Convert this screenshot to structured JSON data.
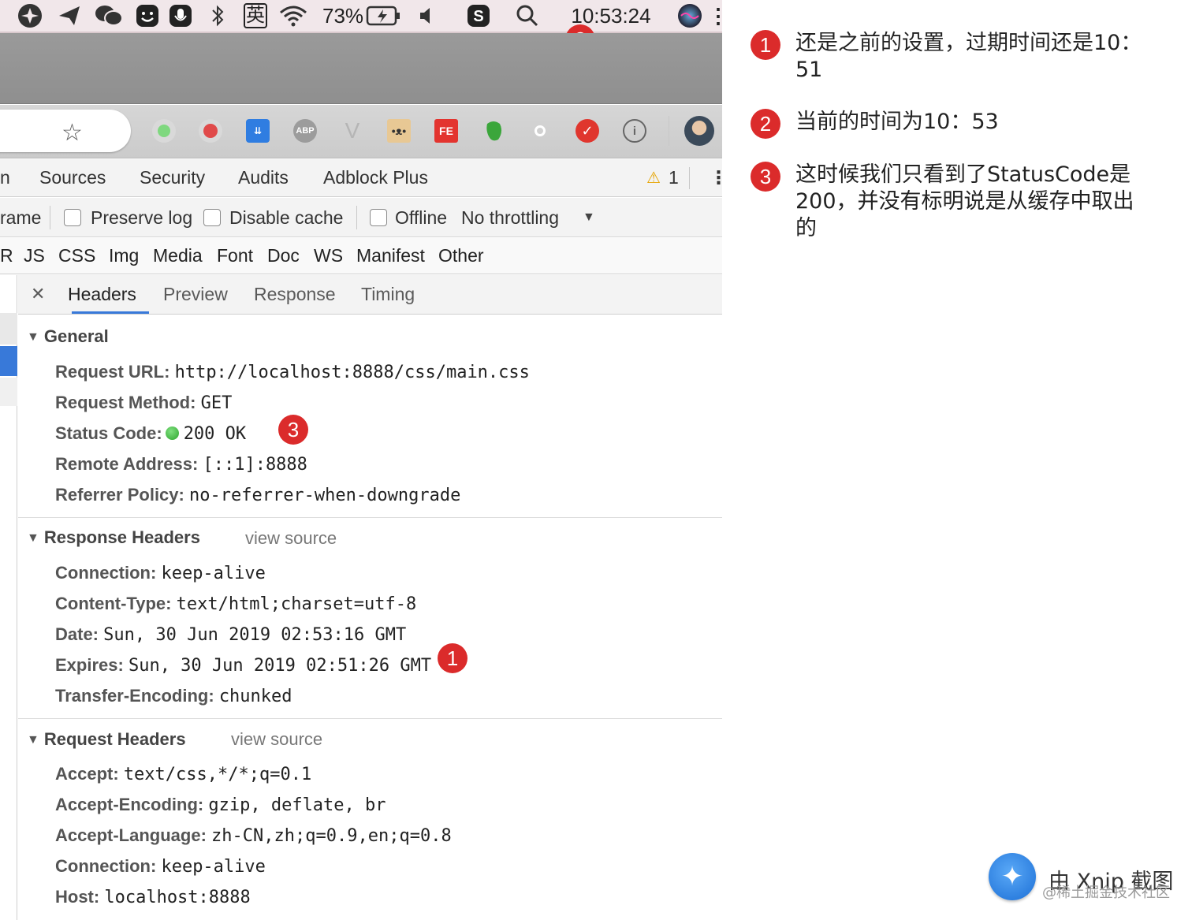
{
  "menubar": {
    "icons": [
      "app-icon",
      "send-icon",
      "wechat-icon",
      "smile-icon",
      "mic-icon",
      "bluetooth-icon",
      "input-method-icon",
      "wifi-icon",
      "battery-icon",
      "volume-icon",
      "s-app-icon",
      "search-icon",
      "siri-icon"
    ],
    "input_method": "英",
    "battery": "73%",
    "clock": "10:53:24"
  },
  "toolbar": {
    "extension_icons": [
      "green-dot-icon",
      "red-dot-icon",
      "download-icon",
      "adblock-plus-icon",
      "vue-icon",
      "cat-icon",
      "fe-icon",
      "evernote-icon",
      "circle-icon",
      "todoist-icon",
      "info-icon"
    ],
    "abp_label": "ABP",
    "fe_label": "FE"
  },
  "devtools": {
    "tabs": [
      "n",
      "Sources",
      "Security",
      "Audits",
      "Adblock Plus"
    ],
    "warning_count": "1",
    "netbar": {
      "frame_label": "rame",
      "preserve_log": "Preserve log",
      "disable_cache": "Disable cache",
      "offline": "Offline",
      "throttling": "No throttling"
    },
    "filters": [
      "R",
      "JS",
      "CSS",
      "Img",
      "Media",
      "Font",
      "Doc",
      "WS",
      "Manifest",
      "Other"
    ],
    "detail_tabs": [
      "Headers",
      "Preview",
      "Response",
      "Timing"
    ],
    "general": {
      "title": "General",
      "rows": [
        {
          "key": "Request URL:",
          "value": "http://localhost:8888/css/main.css"
        },
        {
          "key": "Request Method:",
          "value": "GET"
        },
        {
          "key": "Status Code:",
          "value": "200 OK"
        },
        {
          "key": "Remote Address:",
          "value": "[::1]:8888"
        },
        {
          "key": "Referrer Policy:",
          "value": "no-referrer-when-downgrade"
        }
      ]
    },
    "response_headers": {
      "title": "Response Headers",
      "view_source": "view source",
      "rows": [
        {
          "key": "Connection:",
          "value": "keep-alive"
        },
        {
          "key": "Content-Type:",
          "value": "text/html;charset=utf-8"
        },
        {
          "key": "Date:",
          "value": "Sun, 30 Jun 2019 02:53:16 GMT"
        },
        {
          "key": "Expires:",
          "value": "Sun, 30 Jun 2019 02:51:26 GMT"
        },
        {
          "key": "Transfer-Encoding:",
          "value": "chunked"
        }
      ]
    },
    "request_headers": {
      "title": "Request Headers",
      "view_source": "view source",
      "rows": [
        {
          "key": "Accept:",
          "value": "text/css,*/*;q=0.1"
        },
        {
          "key": "Accept-Encoding:",
          "value": "gzip, deflate, br"
        },
        {
          "key": "Accept-Language:",
          "value": "zh-CN,zh;q=0.9,en;q=0.8"
        },
        {
          "key": "Connection:",
          "value": "keep-alive"
        },
        {
          "key": "Host:",
          "value": "localhost:8888"
        }
      ]
    }
  },
  "badges": {
    "one": "1",
    "two": "2",
    "three": "3"
  },
  "notes": [
    {
      "num": "1",
      "text": "还是之前的设置，过期时间还是10：51"
    },
    {
      "num": "2",
      "text": "当前的时间为10：53"
    },
    {
      "num": "3",
      "text": "这时候我们只看到了StatusCode是200，并没有标明说是从缓存中取出的"
    }
  ],
  "footer": {
    "xnip": "由 Xnip 截图",
    "watermark": "@稀土掘金技术社区"
  }
}
